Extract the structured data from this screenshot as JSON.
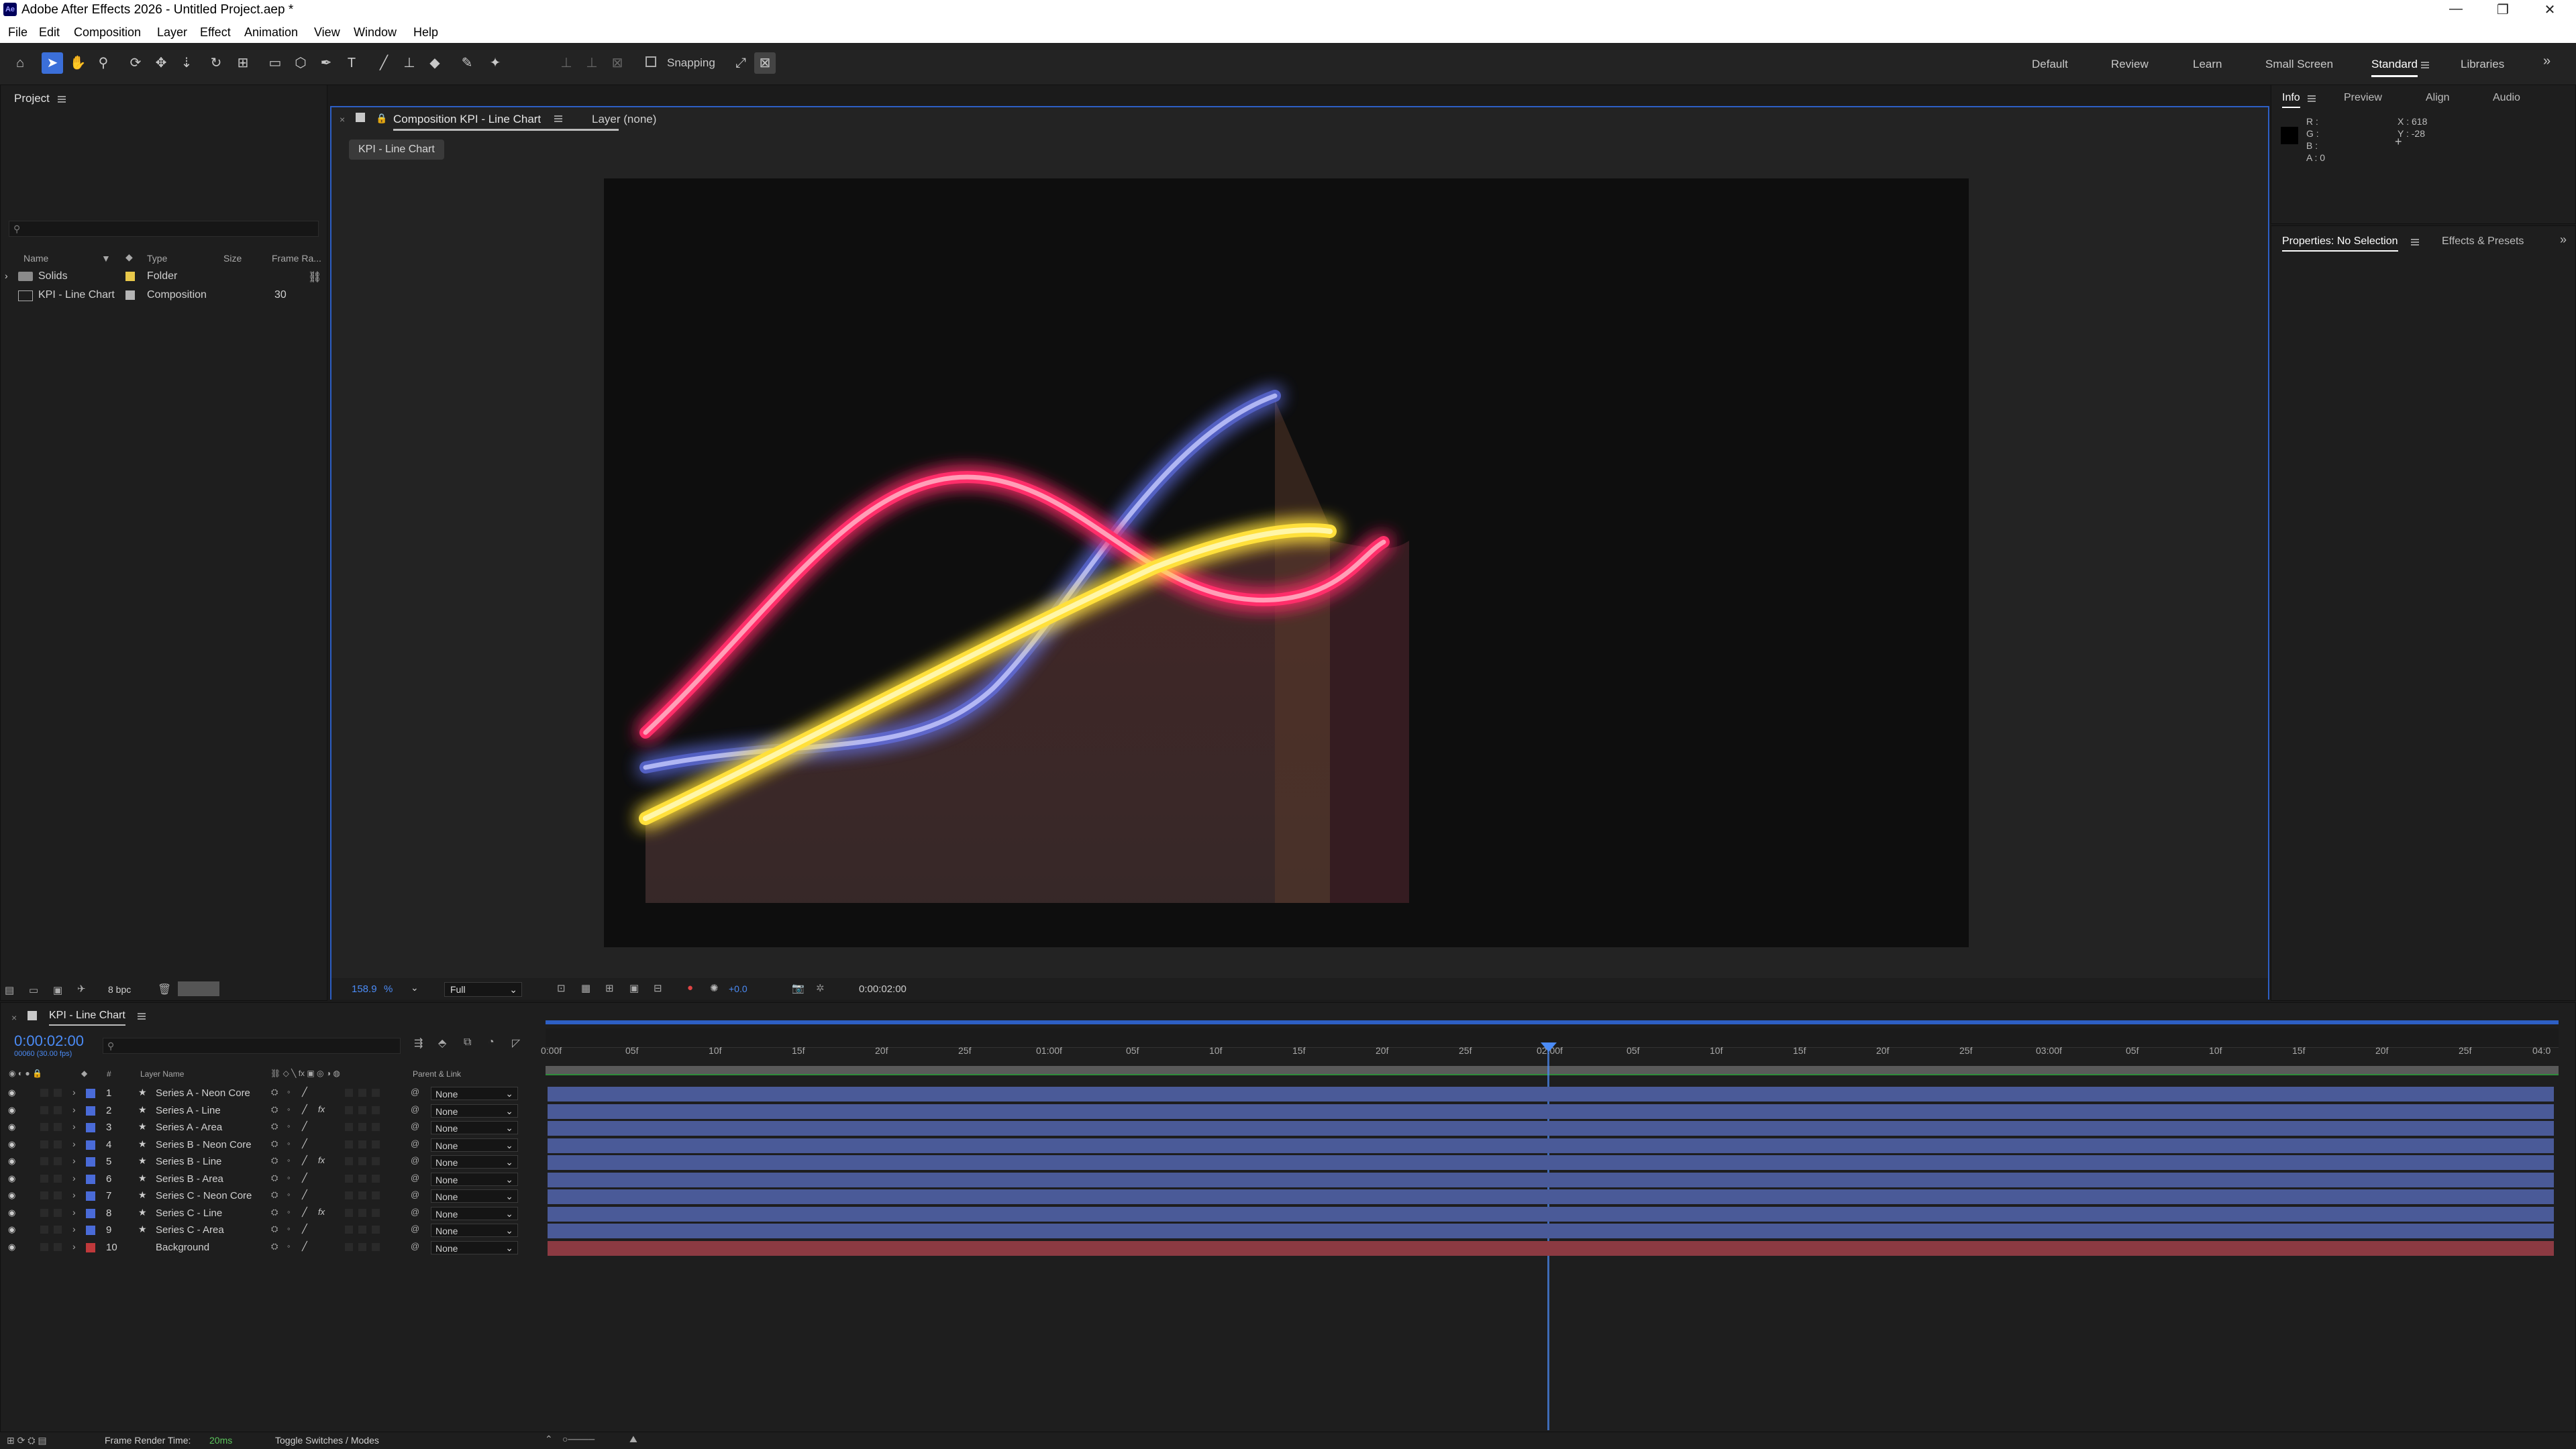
{
  "app": {
    "title": "Adobe After Effects 2026 - Untitled Project.aep *",
    "logo": "Ae",
    "window_controls": [
      "—",
      "❐",
      "✕"
    ]
  },
  "menu": [
    "File",
    "Edit",
    "Composition",
    "Layer",
    "Effect",
    "Animation",
    "View",
    "Window",
    "Help"
  ],
  "toolbar": {
    "snapping_label": "Snapping",
    "workspaces": [
      {
        "label": "Default"
      },
      {
        "label": "Review"
      },
      {
        "label": "Learn"
      },
      {
        "label": "Small Screen"
      },
      {
        "label": "Standard",
        "active": true
      },
      {
        "label": "Libraries"
      }
    ]
  },
  "project": {
    "title": "Project",
    "search_placeholder": "",
    "columns": [
      "Name",
      "Type",
      "Size",
      "Frame Ra..."
    ],
    "items": [
      {
        "name": "Solids",
        "type": "Folder",
        "size": "",
        "fps": "",
        "color": "#e8c84a"
      },
      {
        "name": "KPI - Line Chart",
        "type": "Composition",
        "size": "",
        "fps": "30",
        "color": "#b5b5b5"
      }
    ],
    "bpc": "8 bpc"
  },
  "viewer": {
    "tab_title": "Composition KPI - Line Chart",
    "layer_tab": "Layer (none)",
    "breadcrumb": "KPI - Line Chart",
    "zoom": "158.9",
    "zoom_unit": "%",
    "resolution": "Full",
    "exposure": "+0.0",
    "timecode": "0:00:02:00"
  },
  "info": {
    "tabs": [
      "Info",
      "Preview",
      "Align",
      "Audio"
    ],
    "r": "R :",
    "g": "G :",
    "b": "B :",
    "a": "A :  0",
    "x": "X : 618",
    "y": "Y : -28"
  },
  "properties": {
    "tabs": [
      "Properties: No Selection",
      "Effects & Presets"
    ]
  },
  "timeline": {
    "comp_tab": "KPI - Line Chart",
    "timecode": "0:00:02:00",
    "sub_timecode": "00060 (30.00 fps)",
    "columns": {
      "name": "Layer Name",
      "parent": "Parent & Link",
      "num": "#"
    },
    "ruler": [
      "0:00f",
      "05f",
      "10f",
      "15f",
      "20f",
      "25f",
      "01:00f",
      "05f",
      "10f",
      "15f",
      "20f",
      "25f",
      "02:00f",
      "05f",
      "10f",
      "15f",
      "20f",
      "25f",
      "03:00f",
      "05f",
      "10f",
      "15f",
      "20f",
      "25f",
      "04:0"
    ],
    "layers": [
      {
        "num": "1",
        "name": "Series A - Neon Core",
        "fx": false,
        "parent": "None",
        "color": "#4a6bd8"
      },
      {
        "num": "2",
        "name": "Series A - Line",
        "fx": true,
        "parent": "None",
        "color": "#4a6bd8"
      },
      {
        "num": "3",
        "name": "Series A - Area",
        "fx": false,
        "parent": "None",
        "color": "#4a6bd8"
      },
      {
        "num": "4",
        "name": "Series B - Neon Core",
        "fx": false,
        "parent": "None",
        "color": "#4a6bd8"
      },
      {
        "num": "5",
        "name": "Series B - Line",
        "fx": true,
        "parent": "None",
        "color": "#4a6bd8"
      },
      {
        "num": "6",
        "name": "Series B - Area",
        "fx": false,
        "parent": "None",
        "color": "#4a6bd8"
      },
      {
        "num": "7",
        "name": "Series C - Neon Core",
        "fx": false,
        "parent": "None",
        "color": "#4a6bd8"
      },
      {
        "num": "8",
        "name": "Series C - Line",
        "fx": true,
        "parent": "None",
        "color": "#4a6bd8"
      },
      {
        "num": "9",
        "name": "Series C - Area",
        "fx": false,
        "parent": "None",
        "color": "#4a6bd8"
      },
      {
        "num": "10",
        "name": "Background",
        "fx": false,
        "parent": "None",
        "color": "#c0393b"
      }
    ],
    "fx_label": "fx",
    "footer": {
      "render_label": "Frame Render Time:",
      "render_value": "20ms",
      "toggle": "Toggle Switches / Modes"
    }
  }
}
